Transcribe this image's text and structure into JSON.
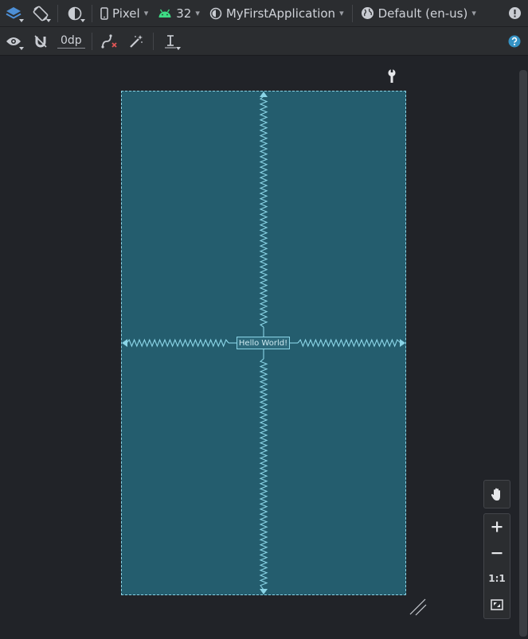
{
  "toolbar": {
    "device": "Pixel",
    "api_level": "32",
    "theme": "MyFirstApplication",
    "locale": "Default (en-us)",
    "default_margin": "0dp"
  },
  "canvas": {
    "text_view": "Hello World!",
    "blueprint_color": "#245d6e",
    "constraint_color": "#8ad4e6"
  },
  "zoom": {
    "actual_size_label": "1:1"
  },
  "colors": {
    "android_green": "#3ddc84",
    "help_blue": "#3592c4",
    "error_red": "#e05555"
  }
}
